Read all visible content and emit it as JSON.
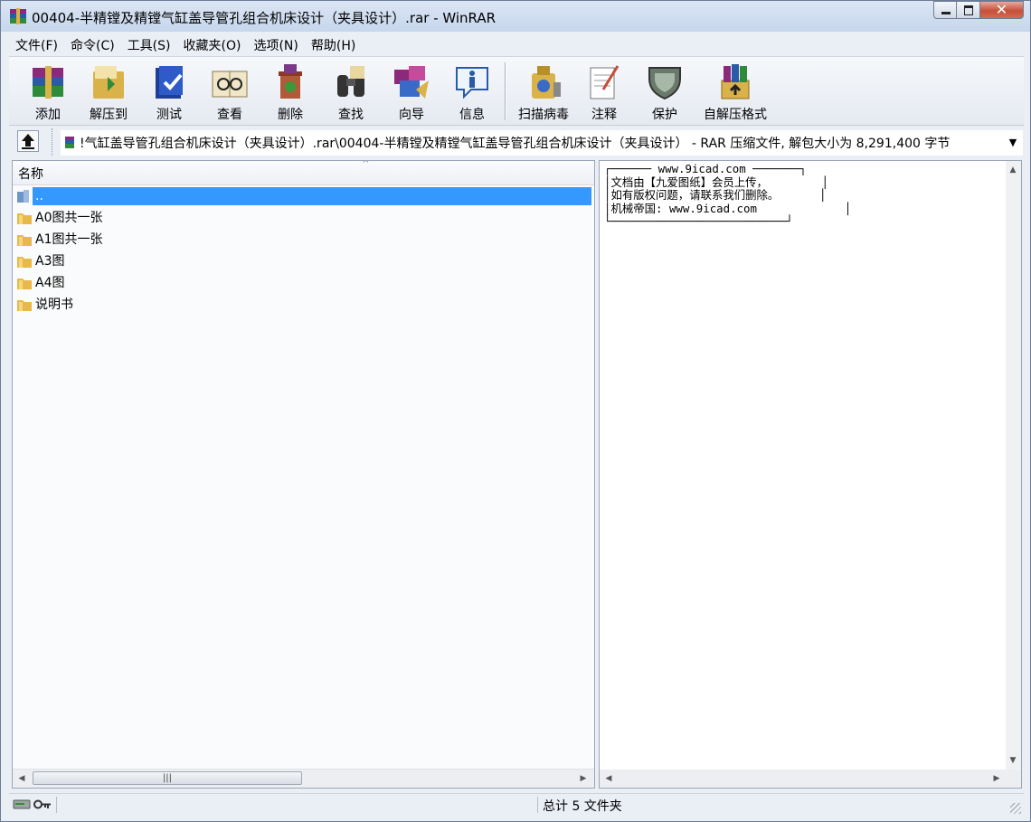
{
  "window": {
    "title": "00404-半精镗及精镗气缸盖导管孔组合机床设计（夹具设计）.rar - WinRAR",
    "app_icon": "winrar-icon",
    "controls": {
      "close_glyph": "✕"
    }
  },
  "menu": [
    "文件(F)",
    "命令(C)",
    "工具(S)",
    "收藏夹(O)",
    "选项(N)",
    "帮助(H)"
  ],
  "toolbar": [
    {
      "label": "添加",
      "icon": "add-archive-icon"
    },
    {
      "label": "解压到",
      "icon": "extract-to-icon"
    },
    {
      "label": "测试",
      "icon": "test-icon"
    },
    {
      "label": "查看",
      "icon": "view-icon"
    },
    {
      "label": "删除",
      "icon": "delete-icon"
    },
    {
      "label": "查找",
      "icon": "find-icon"
    },
    {
      "label": "向导",
      "icon": "wizard-icon"
    },
    {
      "label": "信息",
      "icon": "info-icon"
    },
    {
      "label": "扫描病毒",
      "icon": "virus-scan-icon"
    },
    {
      "label": "注释",
      "icon": "comment-icon"
    },
    {
      "label": "保护",
      "icon": "protect-icon"
    },
    {
      "label": "自解压格式",
      "icon": "sfx-icon"
    }
  ],
  "address": {
    "path": "!气缸盖导管孔组合机床设计（夹具设计）.rar\\00404-半精镗及精镗气缸盖导管孔组合机床设计（夹具设计） - RAR 压缩文件, 解包大小为 8,291,400 字节"
  },
  "file_list": {
    "column_name": "名称",
    "sort_glyph": "^",
    "items": [
      {
        "name": "..",
        "type": "parent",
        "selected": true
      },
      {
        "name": "A0图共一张",
        "type": "folder"
      },
      {
        "name": "A1图共一张",
        "type": "folder"
      },
      {
        "name": "A3图",
        "type": "folder"
      },
      {
        "name": "A4图",
        "type": "folder"
      },
      {
        "name": "说明书",
        "type": "folder"
      }
    ]
  },
  "comment": {
    "lines": [
      "┌────── www.9icad.com ───────┐",
      "│文档由【九爱图纸】会员上传，        │",
      "│如有版权问题，请联系我们删除。      │",
      "│机械帝国: www.9icad.com             │",
      "└──────────────────────────┘"
    ]
  },
  "scrollbar": {
    "left": "◀",
    "right": "▶",
    "up": "▲",
    "down": "▼",
    "grip": "|||"
  },
  "status": {
    "summary": "总计 5 文件夹"
  },
  "colors": {
    "selection": "#3399ff",
    "folder": "#e8b84a"
  }
}
